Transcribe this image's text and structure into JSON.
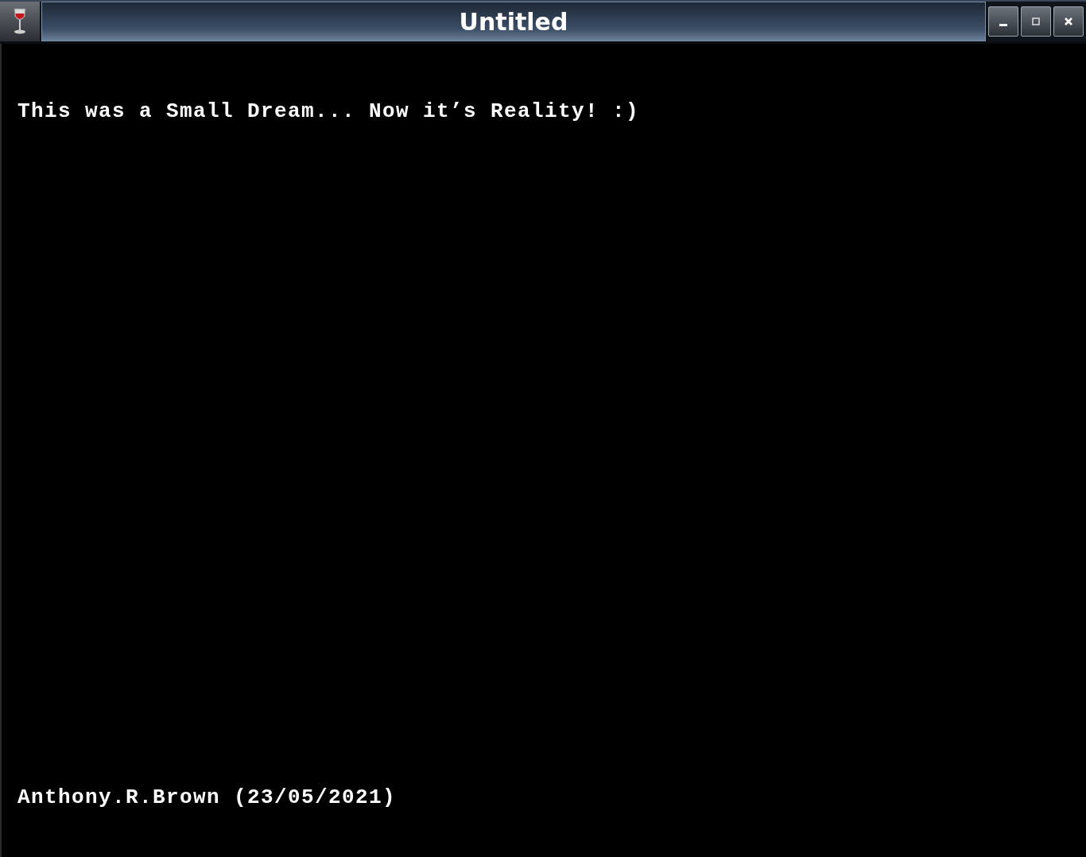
{
  "window": {
    "title": "Untitled"
  },
  "lines": [
    "This was a Small Dream... Now it’s Reality! :)",
    "Anthony.R.Brown (23/05/2021)"
  ]
}
